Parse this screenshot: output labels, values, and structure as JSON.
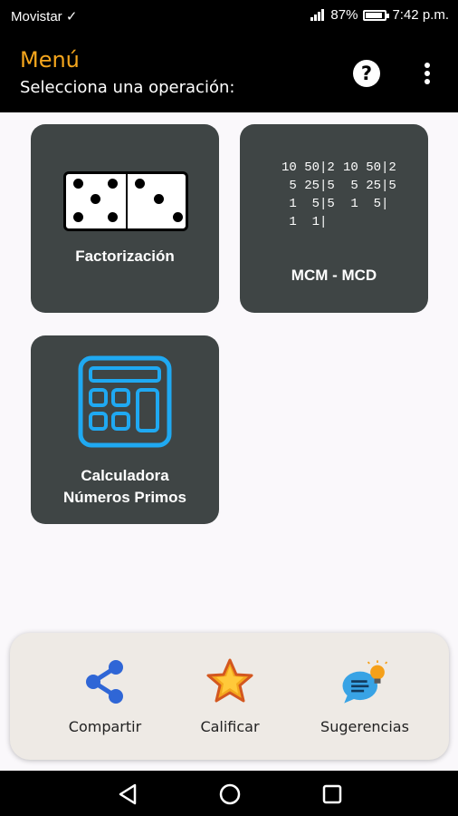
{
  "status_bar": {
    "carrier": "Movistar ✓",
    "battery": "87%",
    "time": "7:42 p.m.",
    "battery_level": 0.87
  },
  "app_bar": {
    "title": "Menú",
    "subtitle": "Selecciona una operación:",
    "help_icon": "question-icon",
    "more_icon": "more-vert-icon",
    "title_color": "#f5a61d"
  },
  "tiles": [
    {
      "label": "Factorización",
      "icon": "domino-icon"
    },
    {
      "label": "MCM - MCD",
      "icon": "division-table-icon",
      "division_left": [
        "10 50|2",
        " 5 25|5",
        " 1  5|5",
        " 1  1|"
      ],
      "division_right": [
        "10 50|2",
        " 5 25|5",
        " 1  5|"
      ]
    },
    {
      "label_line1": "Calculadora",
      "label_line2": "Números Primos",
      "icon": "calculator-icon"
    }
  ],
  "bottom_actions": [
    {
      "label": "Compartir",
      "icon": "share-icon"
    },
    {
      "label": "Calificar",
      "icon": "star-icon"
    },
    {
      "label": "Sugerencias",
      "icon": "chat-lightbulb-icon"
    }
  ],
  "nav_bar": {
    "back_icon": "back-triangle-icon",
    "home_icon": "home-circle-icon",
    "recents_icon": "recents-square-icon"
  },
  "colors": {
    "tile_bg": "#3f4545",
    "accent": "#f5a61d",
    "calc_blue": "#1fa9f2",
    "share_blue": "#2f66d6"
  }
}
